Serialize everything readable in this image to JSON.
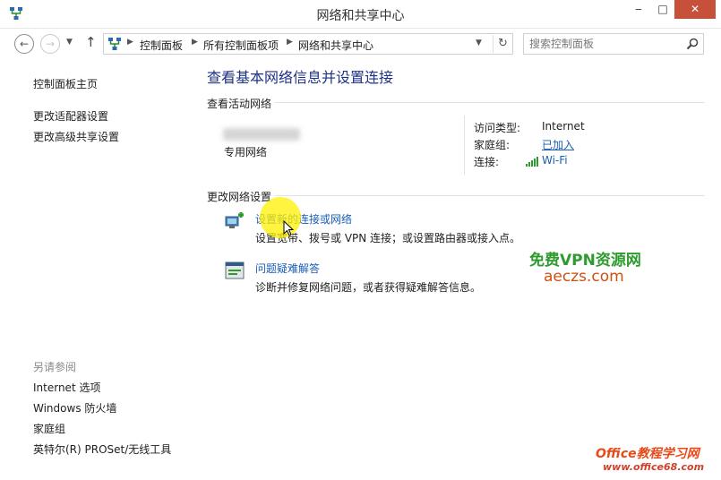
{
  "window": {
    "title": "网络和共享中心",
    "minimize": "‒",
    "maximize": "□",
    "close": "✕"
  },
  "address_bar": {
    "breadcrumbs": [
      "控制面板",
      "所有控制面板项",
      "网络和共享中心"
    ],
    "search_placeholder": "搜索控制面板"
  },
  "sidebar": {
    "home": "控制面板主页",
    "links": [
      "更改适配器设置",
      "更改高级共享设置"
    ],
    "see_also_heading": "另请参阅",
    "see_also": [
      "Internet 选项",
      "Windows 防火墙",
      "家庭组",
      "英特尔(R) PROSet/无线工具"
    ]
  },
  "main": {
    "title": "查看基本网络信息并设置连接",
    "active_networks_heading": "查看活动网络",
    "network": {
      "type": "专用网络",
      "access_type_label": "访问类型:",
      "access_type_value": "Internet",
      "homegroup_label": "家庭组:",
      "homegroup_value": "已加入",
      "connection_label": "连接:",
      "connection_value": "Wi-Fi"
    },
    "change_settings_heading": "更改网络设置",
    "tasks": [
      {
        "link": "设置新的连接或网络",
        "desc": "设置宽带、拨号或 VPN 连接；或设置路由器或接入点。"
      },
      {
        "link": "问题疑难解答",
        "desc": "诊断并修复网络问题，或者获得疑难解答信息。"
      }
    ]
  },
  "watermarks": {
    "line1": "免费VPN资源网",
    "line2": "aeczs.com",
    "badge_top": "Office教程学习网",
    "badge_bottom": "www.office68.com"
  },
  "colors": {
    "link": "#1a5fb4",
    "title": "#1e3287",
    "close_button": "#c7503b"
  }
}
